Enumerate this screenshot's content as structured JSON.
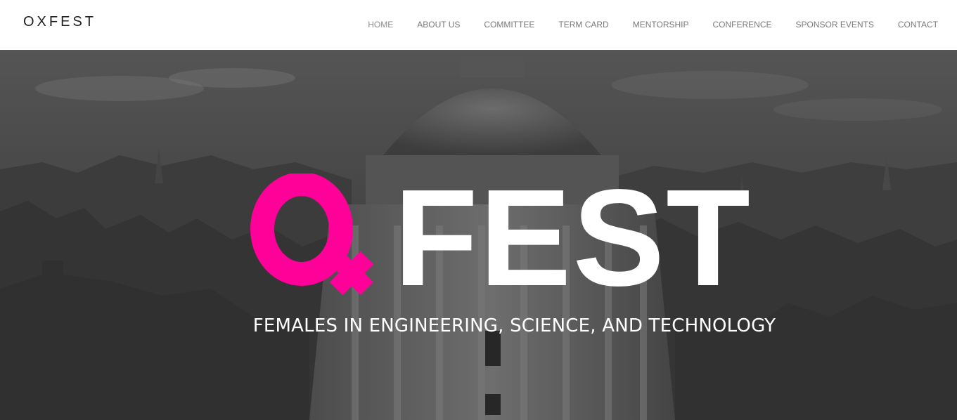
{
  "site": {
    "brand": "OXFEST"
  },
  "nav": {
    "items": [
      {
        "label": "HOME",
        "active": true
      },
      {
        "label": "ABOUT US",
        "active": false
      },
      {
        "label": "COMMITTEE",
        "active": false
      },
      {
        "label": "TERM CARD",
        "active": false
      },
      {
        "label": "MENTORSHIP",
        "active": false
      },
      {
        "label": "CONFERENCE",
        "active": false
      },
      {
        "label": "SPONSOR EVENTS",
        "active": false
      },
      {
        "label": "CONTACT",
        "active": false
      }
    ]
  },
  "hero": {
    "logo_text": "FEST",
    "logo_accent_color": "#ff0099",
    "tagline": "FEMALES IN ENGINEERING, SCIENCE, AND TECHNOLOGY"
  }
}
